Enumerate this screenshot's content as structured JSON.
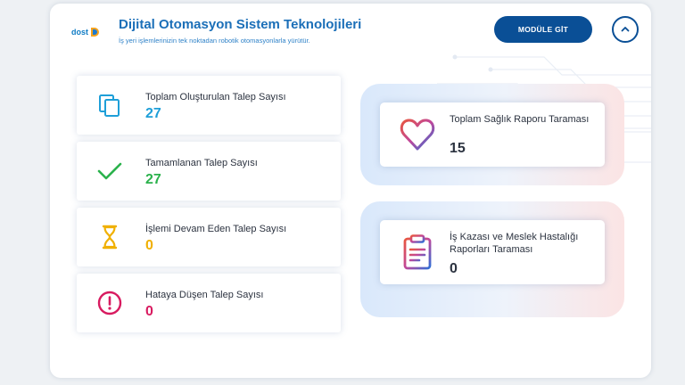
{
  "header": {
    "logo_text": "dost",
    "title": "Dijital Otomasyon Sistem Teknolojileri",
    "subtitle": "İş yeri işlemlerinizin tek noktadan robotik otomasyonlarla yürütür.",
    "module_button": "MODÜLE GİT",
    "collapse_icon": "chevron-up-icon"
  },
  "stats": [
    {
      "label": "Toplam Oluşturulan Talep Sayısı",
      "value": "27",
      "color": "#1e9fd8",
      "icon": "copy-icon"
    },
    {
      "label": "Tamamlanan Talep Sayısı",
      "value": "27",
      "color": "#2bb24c",
      "icon": "check-icon"
    },
    {
      "label": "İşlemi Devam Eden Talep Sayısı",
      "value": "0",
      "color": "#f0b000",
      "icon": "hourglass-icon"
    },
    {
      "label": "Hataya Düşen Talep Sayısı",
      "value": "0",
      "color": "#d81b60",
      "icon": "error-icon"
    }
  ],
  "reports": [
    {
      "label": "Toplam Sağlık Raporu Taraması",
      "value": "15",
      "icon": "heart-icon"
    },
    {
      "label": "İş Kazası ve Meslek Hastalığı Raporları Taraması",
      "value": "0",
      "icon": "clipboard-icon"
    }
  ]
}
